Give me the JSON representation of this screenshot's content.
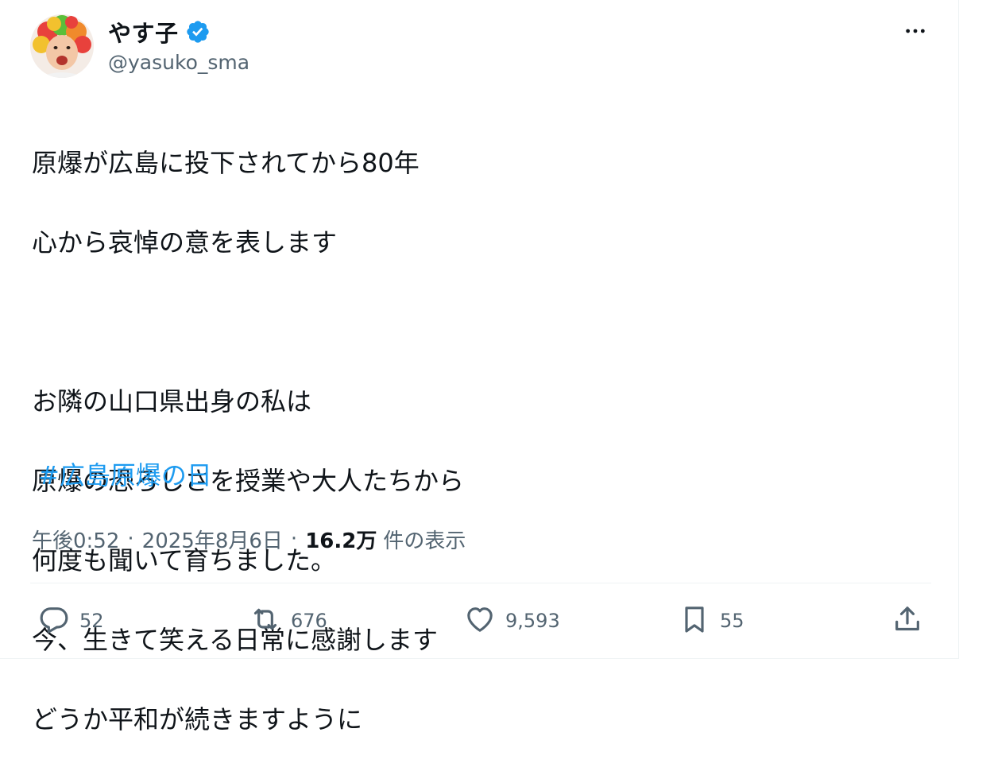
{
  "tweet": {
    "author": {
      "display_name": "やす子",
      "handle": "@yasuko_sma",
      "verified": true
    },
    "body_lines": [
      "原爆が広島に投下されてから80年",
      "心から哀悼の意を表します",
      "",
      "お隣の山口県出身の私は",
      "原爆の恐ろしさを授業や大人たちから",
      "何度も聞いて育ちました。",
      "今、生きて笑える日常に感謝します",
      "どうか平和が続きますように"
    ],
    "hashtag": "#広島原爆の日",
    "time": "午後0:52",
    "date": "2025年8月6日",
    "views_count": "16.2万",
    "views_label": "件の表示",
    "separator": "·"
  },
  "actions": {
    "replies": "52",
    "reposts": "676",
    "likes": "9,593",
    "bookmarks": "55"
  },
  "icons": {
    "verified": "verified-badge-icon",
    "more": "more-dots-icon",
    "reply": "reply-icon",
    "repost": "repost-icon",
    "like": "heart-icon",
    "bookmark": "bookmark-icon",
    "share": "share-icon"
  },
  "colors": {
    "accent": "#1d9bf0",
    "text_primary": "#0f1419",
    "text_secondary": "#536471",
    "divider": "#eff3f4"
  }
}
